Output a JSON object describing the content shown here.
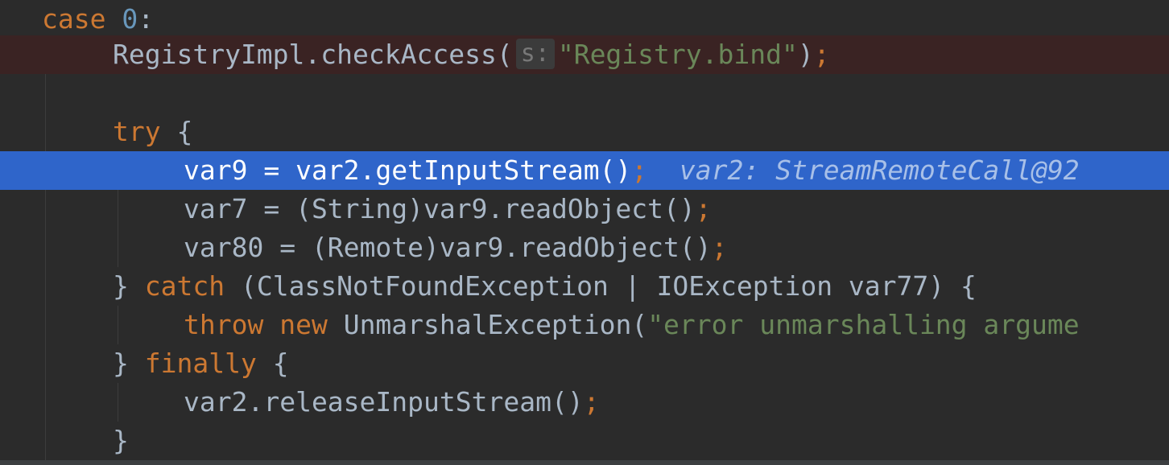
{
  "editor": {
    "lines": [
      {
        "kw1": "case",
        "num": "0",
        "colon": ":"
      },
      {
        "text": "RegistryImpl.checkAccess(",
        "hint": "s:",
        "str": "\"Registry.bind\"",
        "close": ")",
        "semi": ";"
      },
      {},
      {
        "kw1": "try",
        "brace": " {"
      },
      {
        "text": "var9 = var2.getInputStream()",
        "semi": ";",
        "debug": "var2: StreamRemoteCall@92"
      },
      {
        "text": "var7 = (String)var9.readObject()",
        "semi": ";"
      },
      {
        "text": "var80 = (Remote)var9.readObject()",
        "semi": ";"
      },
      {
        "pre": "} ",
        "kw1": "catch",
        "text": " (ClassNotFoundException | IOException var77) {"
      },
      {
        "kw1": "throw",
        "kw2": "new",
        "text": " UnmarshalException(",
        "str": "\"error unmarshalling argume"
      },
      {
        "pre": "} ",
        "kw1": "finally",
        "text": " {"
      },
      {
        "text": "var2.releaseInputStream()",
        "semi": ";"
      },
      {
        "text": "}"
      }
    ]
  }
}
